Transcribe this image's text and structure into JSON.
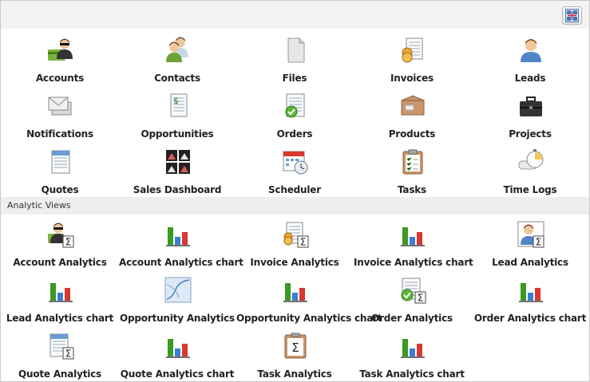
{
  "toolbar": {
    "button_icon": "layout-toggle-icon"
  },
  "main_items": [
    {
      "label": "Accounts",
      "icon": "accounts-icon"
    },
    {
      "label": "Contacts",
      "icon": "contacts-icon"
    },
    {
      "label": "Files",
      "icon": "file-icon"
    },
    {
      "label": "Invoices",
      "icon": "invoices-icon"
    },
    {
      "label": "Leads",
      "icon": "leads-icon"
    },
    {
      "label": "Notifications",
      "icon": "envelope-icon"
    },
    {
      "label": "Opportunities",
      "icon": "opportunities-icon"
    },
    {
      "label": "Orders",
      "icon": "orders-icon"
    },
    {
      "label": "Products",
      "icon": "box-icon"
    },
    {
      "label": "Projects",
      "icon": "briefcase-icon"
    },
    {
      "label": "Quotes",
      "icon": "quotes-icon"
    },
    {
      "label": "Sales Dashboard",
      "icon": "dashboard-icon"
    },
    {
      "label": "Scheduler",
      "icon": "calendar-clock-icon"
    },
    {
      "label": "Tasks",
      "icon": "clipboard-icon"
    },
    {
      "label": "Time Logs",
      "icon": "stopwatch-icon"
    }
  ],
  "analytic_section": {
    "title": "Analytic Views"
  },
  "analytic_items": [
    {
      "label": "Account Analytics",
      "icon": "account-analytics-icon"
    },
    {
      "label": "Account Analytics chart",
      "icon": "bar-chart-icon"
    },
    {
      "label": "Invoice Analytics",
      "icon": "invoice-analytics-icon"
    },
    {
      "label": "Invoice Analytics chart",
      "icon": "bar-chart-icon"
    },
    {
      "label": "Lead Analytics",
      "icon": "lead-analytics-icon"
    },
    {
      "label": "Lead Analytics chart",
      "icon": "bar-chart-icon"
    },
    {
      "label": "Opportunity Analytics",
      "icon": "line-graph-icon"
    },
    {
      "label": "Opportunity Analytics chart",
      "icon": "bar-chart-icon"
    },
    {
      "label": "Order Analytics",
      "icon": "order-analytics-icon"
    },
    {
      "label": "Order Analytics chart",
      "icon": "bar-chart-icon"
    },
    {
      "label": "Quote Analytics",
      "icon": "quote-analytics-icon"
    },
    {
      "label": "Quote Analytics chart",
      "icon": "bar-chart-icon"
    },
    {
      "label": "Task Analytics",
      "icon": "task-analytics-icon"
    },
    {
      "label": "Task Analytics chart",
      "icon": "bar-chart-icon"
    }
  ]
}
